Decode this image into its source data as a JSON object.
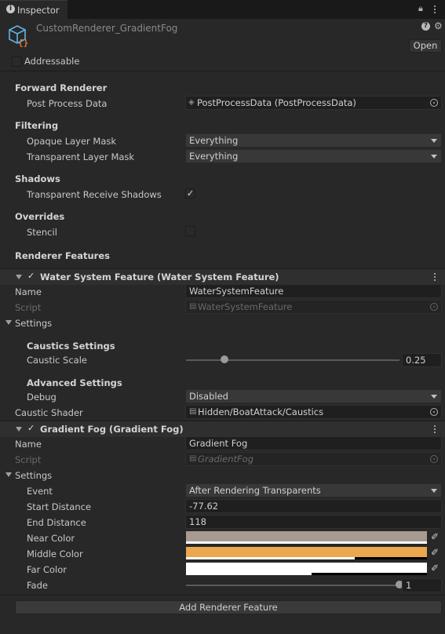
{
  "tab": {
    "title": "Inspector",
    "icon": "info-icon"
  },
  "asset": {
    "name": "CustomRenderer_GradientFog",
    "icon": "scriptable-object-icon",
    "open_label": "Open",
    "addressable_label": "Addressable"
  },
  "forward_renderer": {
    "header": "Forward Renderer",
    "post_process_label": "Post Process Data",
    "post_process_value": "PostProcessData (PostProcessData)"
  },
  "filtering": {
    "header": "Filtering",
    "opaque_label": "Opaque Layer Mask",
    "opaque_value": "Everything",
    "transparent_label": "Transparent Layer Mask",
    "transparent_value": "Everything"
  },
  "shadows": {
    "header": "Shadows",
    "receive_label": "Transparent Receive Shadows",
    "receive_checked": true
  },
  "overrides": {
    "header": "Overrides",
    "stencil_label": "Stencil",
    "stencil_checked": false
  },
  "renderer_features_header": "Renderer Features",
  "water_feature": {
    "title": "Water System Feature (Water System Feature)",
    "enabled": true,
    "name_label": "Name",
    "name_value": "WaterSystemFeature",
    "script_label": "Script",
    "script_value": "WaterSystemFeature",
    "settings_label": "Settings",
    "caustics_header": "Caustics Settings",
    "caustic_scale_label": "Caustic Scale",
    "caustic_scale_value": "0.25",
    "caustic_scale_fraction": 0.18,
    "advanced_header": "Advanced Settings",
    "debug_label": "Debug",
    "debug_value": "Disabled",
    "caustic_shader_label": "Caustic Shader",
    "caustic_shader_value": "Hidden/BoatAttack/Caustics"
  },
  "gradient_fog": {
    "title": "Gradient Fog (Gradient Fog)",
    "enabled": true,
    "name_label": "Name",
    "name_value": "Gradient Fog",
    "script_label": "Script",
    "script_value": "GradientFog",
    "settings_label": "Settings",
    "event_label": "Event",
    "event_value": "After Rendering Transparents",
    "start_distance_label": "Start Distance",
    "start_distance_value": "-77.62",
    "end_distance_label": "End Distance",
    "end_distance_value": "118",
    "near_color_label": "Near Color",
    "near_color": "#a79a91",
    "middle_color_label": "Middle Color",
    "middle_color": "#eca84e",
    "far_color_label": "Far Color",
    "far_color": "#ffffff",
    "fade_label": "Fade",
    "fade_value": "1",
    "fade_fraction": 1.0
  },
  "add_feature_button": "Add Renderer Feature"
}
